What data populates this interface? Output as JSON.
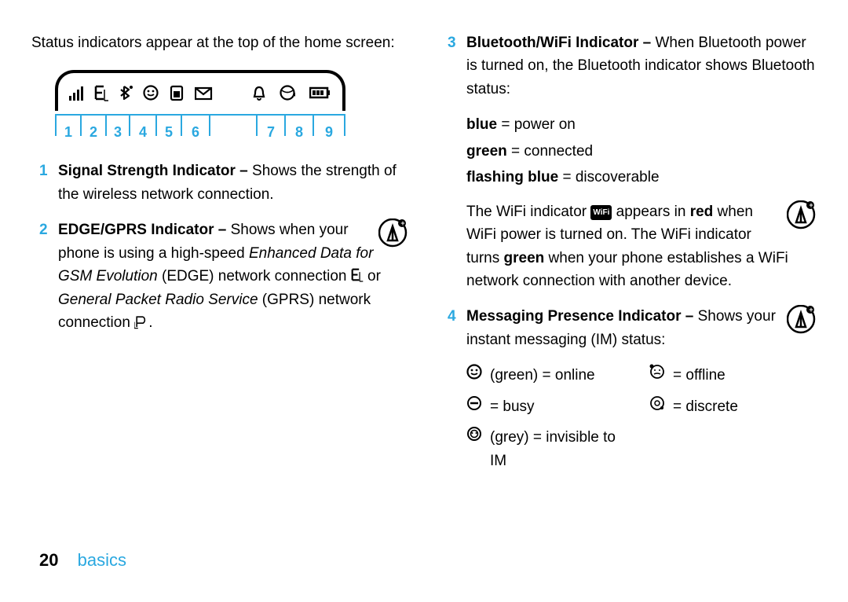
{
  "intro": "Status indicators appear at the top of the home screen:",
  "callouts": [
    "1",
    "2",
    "3",
    "4",
    "5",
    "6",
    "",
    "7",
    "8",
    "9"
  ],
  "items": {
    "i1": {
      "num": "1",
      "title": "Signal Strength Indicator – ",
      "text": "Shows the strength of the wireless network connection."
    },
    "i2": {
      "num": "2",
      "title": "EDGE/GPRS Indicator – ",
      "text_a": "Shows when your phone is using a high-speed ",
      "em_a": "Enhanced Data for GSM Evolution",
      "text_b": " (EDGE) network connection ",
      "text_c": " or ",
      "em_b": "General Packet Radio Service",
      "text_d": " (GPRS) network connection ",
      "text_e": "."
    },
    "i3": {
      "num": "3",
      "title": "Bluetooth/WiFi Indicator – ",
      "text": "When Bluetooth power is turned on, the Bluetooth indicator shows Bluetooth status:",
      "k1b": "blue",
      "k1": " = power on",
      "k2b": "green",
      "k2": " = connected",
      "k3b": "flashing blue",
      "k3": " = discoverable",
      "wifi_a": "The WiFi indicator ",
      "wifi_chip": "WiFi",
      "wifi_b": " appears in ",
      "wifi_red": "red",
      "wifi_c": " when WiFi power is turned on. The WiFi indicator turns ",
      "wifi_green": "green",
      "wifi_d": " when your phone establishes a WiFi network connection with another device."
    },
    "i4": {
      "num": "4",
      "title": "Messaging Presence Indicator – ",
      "text": "Shows your instant messaging (IM) status:",
      "s1": "(green) = online",
      "s2": "= offline",
      "s3": "= busy",
      "s4": "= discrete",
      "s5": "(grey) = invisible to IM"
    }
  },
  "footer": {
    "page": "20",
    "section": "basics"
  }
}
